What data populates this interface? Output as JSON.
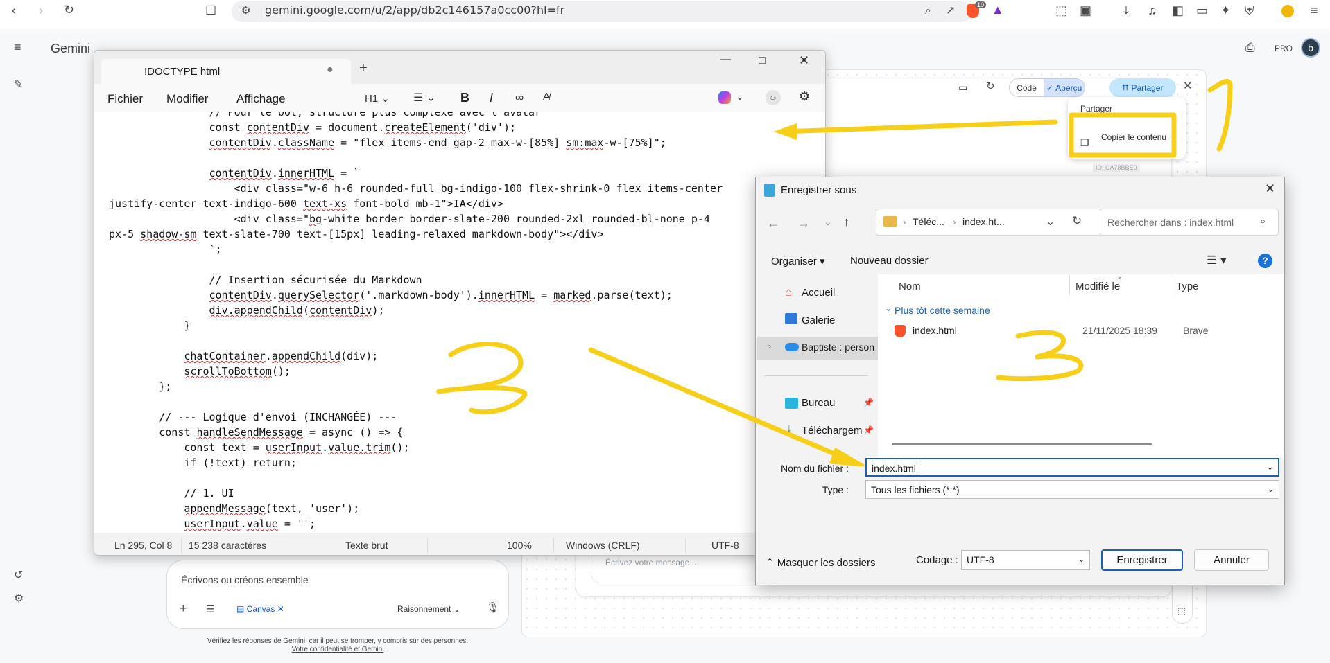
{
  "browser": {
    "url": "gemini.google.com/u/2/app/db2c146157a0cc00?hl=fr",
    "brave_badge": "10"
  },
  "gemini": {
    "app_title": "Gemini",
    "pro_badge": "PRO",
    "avatar_initial": "b",
    "preview_toolbar": {
      "code": "Code",
      "preview": "Aperçu",
      "share": "Partager"
    },
    "share_menu": {
      "share": "Partager",
      "copy": "Copier le contenu",
      "id_tag": "ID: CA78BBE0"
    },
    "input_placeholder": "Écrivons ou créons ensemble",
    "canvas_chip": "Canvas",
    "reasoning": "Raisonnement",
    "canvas_msg_placeholder": "Écrivez votre message...",
    "disclaimer": "Vérifiez les réponses de Gemini, car il peut se tromper, y compris sur des personnes.",
    "privacy_link": "Votre confidentialité et Gemini"
  },
  "notepad": {
    "tab_title": "!DOCTYPE html",
    "menus": [
      "Fichier",
      "Modifier",
      "Affichage"
    ],
    "heading_select": "H1",
    "status": {
      "position": "Ln 295, Col 8",
      "chars": "15 238 caractères",
      "format": "Texte brut",
      "zoom": "100%",
      "eol": "Windows (CRLF)",
      "encoding": "UTF-8"
    }
  },
  "dialog": {
    "title": "Enregistrer sous",
    "breadcrumb": [
      "Téléc...",
      "index.ht..."
    ],
    "search_placeholder": "Rechercher dans : index.html",
    "organize": "Organiser",
    "new_folder": "Nouveau dossier",
    "nav": [
      "Accueil",
      "Galerie",
      "Baptiste : person",
      "Bureau",
      "Téléchargem"
    ],
    "columns": {
      "name": "Nom",
      "modified": "Modifié le",
      "type": "Type"
    },
    "group": "Plus tôt cette semaine",
    "file": {
      "name": "index.html",
      "modified": "21/11/2025 18:39",
      "type": "Brave"
    },
    "filename_label": "Nom du fichier :",
    "filename_value": "index.html",
    "type_label": "Type :",
    "type_value": "Tous les fichiers  (*.*)",
    "hide_folders": "Masquer les dossiers",
    "encoding_label": "Codage :",
    "encoding_value": "UTF-8",
    "save": "Enregistrer",
    "cancel": "Annuler"
  },
  "annotations": {
    "colors": {
      "yellow": "#f7cf19"
    }
  }
}
